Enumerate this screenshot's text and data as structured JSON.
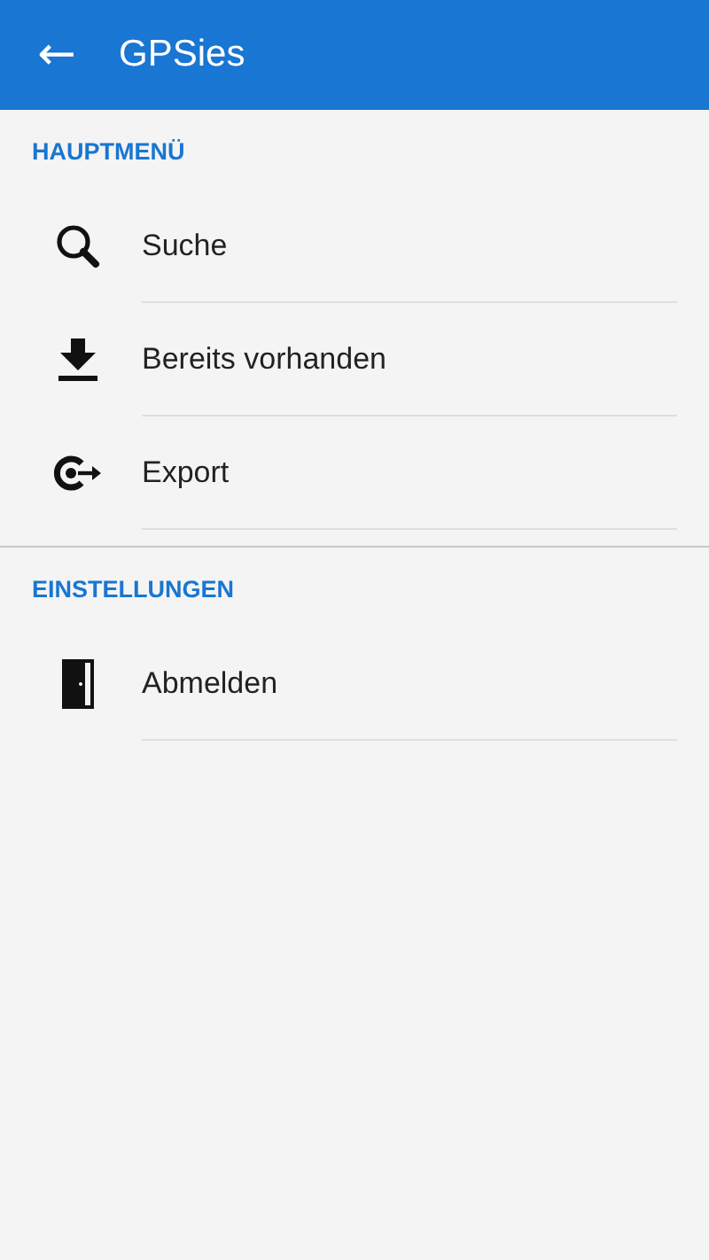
{
  "toolbar": {
    "back_icon": "←",
    "title": "GPSies"
  },
  "sections": [
    {
      "header": "HAUPTMENÜ",
      "items": [
        {
          "label": "Suche",
          "kind": "search"
        },
        {
          "label": "Bereits vorhanden",
          "kind": "download"
        },
        {
          "label": "Export",
          "kind": "export"
        }
      ]
    },
    {
      "header": "EINSTELLUNGEN",
      "items": [
        {
          "label": "Abmelden",
          "kind": "door"
        }
      ]
    }
  ]
}
